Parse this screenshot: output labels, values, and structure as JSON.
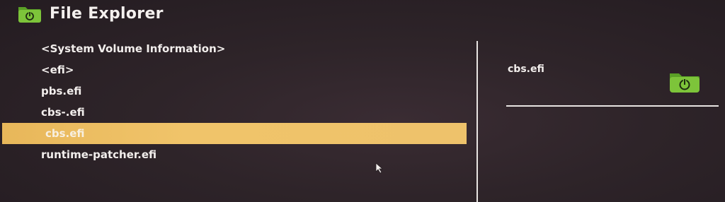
{
  "header": {
    "title": "File Explorer",
    "icon": "folder-power-icon"
  },
  "files": [
    {
      "name": "<System Volume Information>",
      "selected": false
    },
    {
      "name": "<efi>",
      "selected": false
    },
    {
      "name": "pbs.efi",
      "selected": false
    },
    {
      "name": "cbs-.efi",
      "selected": false
    },
    {
      "name": "cbs.efi",
      "selected": true
    },
    {
      "name": "runtime-patcher.efi",
      "selected": false
    }
  ],
  "preview": {
    "filename": "cbs.efi",
    "icon": "folder-power-icon"
  },
  "colors": {
    "accent_green": "#7dc43a",
    "selection": "#eec26b",
    "background": "#2e2429",
    "text": "#f2eeec"
  }
}
